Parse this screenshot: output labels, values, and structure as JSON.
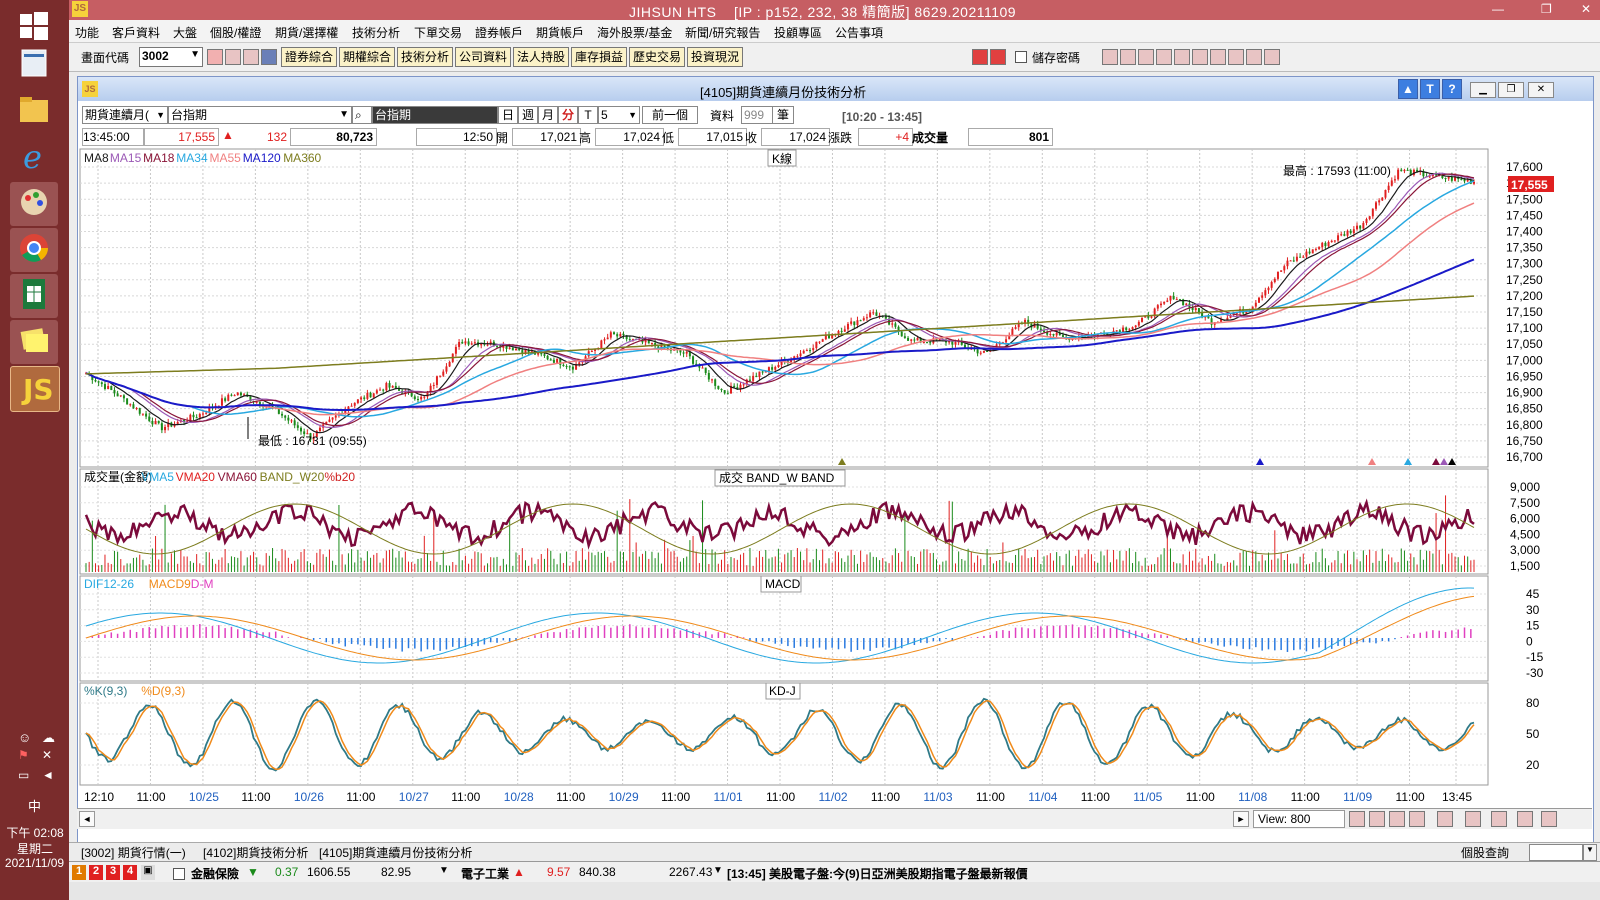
{
  "app": {
    "title": "JIHSUN HTS",
    "ip_info": "[IP : p152, 232, 38 精簡版] 8629.20211109"
  },
  "menu": [
    "功能",
    "客戶資料",
    "大盤",
    "個股/權證",
    "期貨/選擇權",
    "技術分析",
    "下單交易",
    "證券帳戶",
    "期貨帳戶",
    "海外股票/基金",
    "新聞/研究報告",
    "投顧專區",
    "公告事項"
  ],
  "toolbar": {
    "code_label": "畫面代碼",
    "code_value": "3002",
    "buttons": [
      "證券綜合",
      "期權綜合",
      "技術分析",
      "公司資料",
      "法人持股",
      "庫存損益",
      "歷史交易",
      "投資現況"
    ],
    "save_password": "儲存密碼"
  },
  "window": {
    "title": "[4105]期貨連續月份技術分析"
  },
  "query": {
    "product_type": "期貨連續月(",
    "product": "台指期",
    "product_name": "台指期",
    "periods": [
      "日",
      "週",
      "月",
      "分",
      "T"
    ],
    "interval": "5",
    "prev_button": "前一個",
    "data_label": "資料",
    "data_count": "999",
    "bars_label": "筆",
    "range": "[10:20 - 13:45]"
  },
  "quote": {
    "time": "13:45:00",
    "price": "17,555",
    "change": "132",
    "volume_total": "80,723",
    "bar_time": "12:50",
    "open_label": "開",
    "open": "17,021",
    "high_label": "高",
    "high": "17,024",
    "low_label": "低",
    "low": "17,015",
    "close_label": "收",
    "close": "17,024",
    "chg_label": "漲跌",
    "chg": "+4",
    "vol_label": "成交量",
    "vol": "801"
  },
  "colors": {
    "ma8": "#1a1a1a",
    "ma15": "#9b59b6",
    "ma18": "#8a1538",
    "ma34": "#28a8e0",
    "ma55": "#f08080",
    "ma120": "#1a1ac8",
    "ma360": "#7d7d1f",
    "up": "#e02020",
    "down": "#1a8a1a",
    "vma": "#7b0a3b",
    "macd_pos": "#e040c0",
    "macd_neg": "#2a7ae0",
    "k": "#2f7a88",
    "d": "#f08a1a"
  },
  "panels": {
    "kline": {
      "title": "K線",
      "legend": [
        "MA8",
        "MA15",
        "MA18",
        "MA34",
        "MA55",
        "MA120",
        "MA360"
      ],
      "max_note": "最高 : 17593 (11:00)",
      "min_note": "最低 : 16731 (09:55)",
      "last_price": "17,555"
    },
    "volume": {
      "title": "成交  BAND_W  BAND",
      "legend": [
        "成交量(金額)",
        "VMA5",
        "VMA20",
        "VMA60",
        "BAND_W20",
        "%b20"
      ]
    },
    "macd": {
      "title": "MACD",
      "legend": [
        "DIF12-26",
        "MACD9",
        "D-M"
      ]
    },
    "kd": {
      "title": "KD-J",
      "legend": [
        "%K(9,3)",
        "%D(9,3)"
      ]
    }
  },
  "chart_data": {
    "type": "candlestick",
    "title": "K線",
    "y_ticks_price": [
      "17,600",
      "17,550",
      "17,500",
      "17,450",
      "17,400",
      "17,350",
      "17,300",
      "17,250",
      "17,200",
      "17,150",
      "17,100",
      "17,050",
      "17,000",
      "16,950",
      "16,900",
      "16,850",
      "16,800",
      "16,750",
      "16,700"
    ],
    "ylim_price": [
      16700,
      17625
    ],
    "y_ticks_volume": [
      "9,000",
      "7,500",
      "6,000",
      "4,500",
      "3,000",
      "1,500"
    ],
    "y_ticks_macd": [
      "45",
      "30",
      "15",
      "0",
      "-15",
      "-30"
    ],
    "y_ticks_kd": [
      "80",
      "50",
      "20"
    ],
    "x_labels": [
      "12:10",
      "11:00",
      "10/25",
      "11:00",
      "10/26",
      "11:00",
      "10/27",
      "11:00",
      "10/28",
      "11:00",
      "10/29",
      "11:00",
      "11/01",
      "11:00",
      "11/02",
      "11:00",
      "11/03",
      "11:00",
      "11/04",
      "11:00",
      "11/05",
      "11:00",
      "11/08",
      "11:00",
      "11/09",
      "11:00",
      "13:45"
    ],
    "price_path": [
      16960,
      16880,
      16790,
      16830,
      16900,
      16850,
      16760,
      16860,
      16920,
      16880,
      17060,
      17050,
      17020,
      16980,
      17080,
      17050,
      17020,
      16900,
      16960,
      17020,
      17090,
      17150,
      17060,
      17060,
      17020,
      17120,
      17070,
      17080,
      17110,
      17200,
      17120,
      17160,
      17300,
      17360,
      17420,
      17590,
      17570,
      17555
    ],
    "high": 17593,
    "low": 16731,
    "last": 17555
  },
  "bottom": {
    "scroll_view": "View: 800",
    "tabs": [
      "[3002] 期貨行情(一)",
      "[4102]期貨技術分析",
      "[4105]期貨連續月份技術分析"
    ],
    "query_label": "個股查詢",
    "status": {
      "s1_name": "金融保險",
      "s1_chg": "0.37",
      "s1_val": "1606.55",
      "s1_vol": "82.95",
      "s2_name": "電子工業",
      "s2_chg": "9.57",
      "s2_val": "840.38",
      "s2_vol": "2267.43",
      "news": "[13:45] 美股電子盤:今(9)日亞洲美股期指電子盤最新報價"
    }
  },
  "clock": {
    "time": "下午 02:08",
    "weekday": "星期二",
    "date": "2021/11/09",
    "ime": "中"
  }
}
